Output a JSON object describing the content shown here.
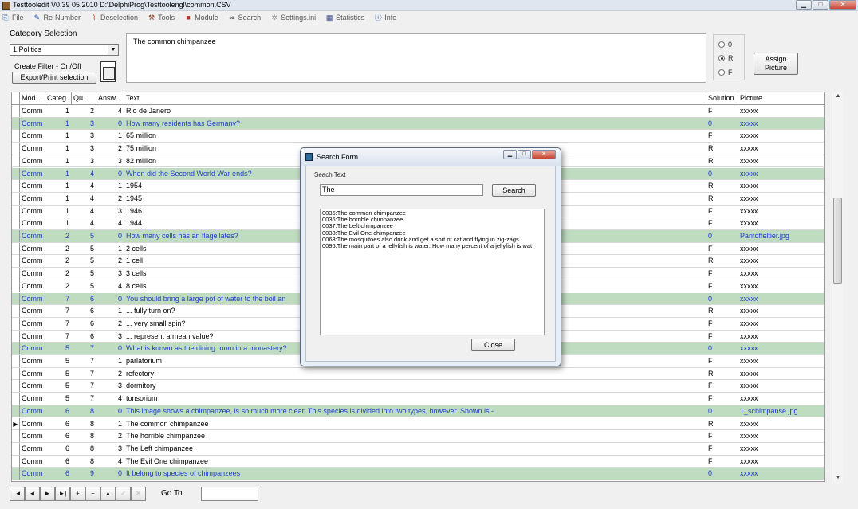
{
  "window": {
    "title": "Testtooledit V0.39 05.2010 D:\\DelphiProg\\Testtoolengl\\common.CSV"
  },
  "menu": [
    {
      "label": "File",
      "icon": "open-icon"
    },
    {
      "label": "Re-Number",
      "icon": "pen-icon"
    },
    {
      "label": "Deselection",
      "icon": "broom-icon"
    },
    {
      "label": "Tools",
      "icon": "tools-icon"
    },
    {
      "label": "Module",
      "icon": "module-icon"
    },
    {
      "label": "Search",
      "icon": "binoculars-icon"
    },
    {
      "label": "Settings.ini",
      "icon": "settings-icon"
    },
    {
      "label": "Statistics",
      "icon": "statistics-icon"
    },
    {
      "label": "Info",
      "icon": "info-icon"
    }
  ],
  "category": {
    "label": "Category Selection",
    "selected": "1.Politics"
  },
  "filter": {
    "create_label": "Create Filter - On/Off",
    "export_label": "Export/Print selection"
  },
  "memo": {
    "text": "The common chimpanzee"
  },
  "radios": [
    {
      "label": "0",
      "checked": false
    },
    {
      "label": "R",
      "checked": true
    },
    {
      "label": "F",
      "checked": false
    }
  ],
  "assign_picture": {
    "label_line1": "Assign",
    "label_line2": "Picture"
  },
  "grid": {
    "headers": [
      "Mod...",
      "Categ...",
      "Qu...",
      "Answ...",
      "Text",
      "Solution",
      "Picture"
    ],
    "rows": [
      {
        "mod": "Comm",
        "cat": "1",
        "qu": "2",
        "ans": "4",
        "text": "Rio de Janero",
        "sol": "F",
        "pic": "xxxxx",
        "q": false
      },
      {
        "mod": "Comm",
        "cat": "1",
        "qu": "3",
        "ans": "0",
        "text": "How many residents has Germany?",
        "sol": "0",
        "pic": "xxxxx",
        "q": true
      },
      {
        "mod": "Comm",
        "cat": "1",
        "qu": "3",
        "ans": "1",
        "text": "65 million",
        "sol": "F",
        "pic": "xxxxx",
        "q": false
      },
      {
        "mod": "Comm",
        "cat": "1",
        "qu": "3",
        "ans": "2",
        "text": "75 million",
        "sol": "R",
        "pic": "xxxxx",
        "q": false
      },
      {
        "mod": "Comm",
        "cat": "1",
        "qu": "3",
        "ans": "3",
        "text": "82 million",
        "sol": "R",
        "pic": "xxxxx",
        "q": false
      },
      {
        "mod": "Comm",
        "cat": "1",
        "qu": "4",
        "ans": "0",
        "text": "When did the Second World War ends?",
        "sol": "0",
        "pic": "xxxxx",
        "q": true
      },
      {
        "mod": "Comm",
        "cat": "1",
        "qu": "4",
        "ans": "1",
        "text": "1954",
        "sol": "R",
        "pic": "xxxxx",
        "q": false
      },
      {
        "mod": "Comm",
        "cat": "1",
        "qu": "4",
        "ans": "2",
        "text": "1945",
        "sol": "R",
        "pic": "xxxxx",
        "q": false
      },
      {
        "mod": "Comm",
        "cat": "1",
        "qu": "4",
        "ans": "3",
        "text": "1946",
        "sol": "F",
        "pic": "xxxxx",
        "q": false
      },
      {
        "mod": "Comm",
        "cat": "1",
        "qu": "4",
        "ans": "4",
        "text": "1944",
        "sol": "F",
        "pic": "xxxxx",
        "q": false
      },
      {
        "mod": "Comm",
        "cat": "2",
        "qu": "5",
        "ans": "0",
        "text": "How many cells has an flagellates?",
        "sol": "0",
        "pic": "Pantoffeltier.jpg",
        "q": true
      },
      {
        "mod": "Comm",
        "cat": "2",
        "qu": "5",
        "ans": "1",
        "text": "2 cells",
        "sol": "F",
        "pic": "xxxxx",
        "q": false
      },
      {
        "mod": "Comm",
        "cat": "2",
        "qu": "5",
        "ans": "2",
        "text": "1 cell",
        "sol": "R",
        "pic": "xxxxx",
        "q": false
      },
      {
        "mod": "Comm",
        "cat": "2",
        "qu": "5",
        "ans": "3",
        "text": "3 cells",
        "sol": "F",
        "pic": "xxxxx",
        "q": false
      },
      {
        "mod": "Comm",
        "cat": "2",
        "qu": "5",
        "ans": "4",
        "text": "8 cells",
        "sol": "F",
        "pic": "xxxxx",
        "q": false
      },
      {
        "mod": "Comm",
        "cat": "7",
        "qu": "6",
        "ans": "0",
        "text": "You should bring a large pot of water to the boil an",
        "sol": "0",
        "pic": "xxxxx",
        "q": true
      },
      {
        "mod": "Comm",
        "cat": "7",
        "qu": "6",
        "ans": "1",
        "text": "... fully turn on?",
        "sol": "R",
        "pic": "xxxxx",
        "q": false
      },
      {
        "mod": "Comm",
        "cat": "7",
        "qu": "6",
        "ans": "2",
        "text": "... very small spin?",
        "sol": "F",
        "pic": "xxxxx",
        "q": false
      },
      {
        "mod": "Comm",
        "cat": "7",
        "qu": "6",
        "ans": "3",
        "text": "... represent a mean value?",
        "sol": "F",
        "pic": "xxxxx",
        "q": false
      },
      {
        "mod": "Comm",
        "cat": "5",
        "qu": "7",
        "ans": "0",
        "text": "What is known as the dining room in a monastery?",
        "sol": "0",
        "pic": "xxxxx",
        "q": true
      },
      {
        "mod": "Comm",
        "cat": "5",
        "qu": "7",
        "ans": "1",
        "text": "parlatorium",
        "sol": "F",
        "pic": "xxxxx",
        "q": false
      },
      {
        "mod": "Comm",
        "cat": "5",
        "qu": "7",
        "ans": "2",
        "text": "refectory",
        "sol": "R",
        "pic": "xxxxx",
        "q": false
      },
      {
        "mod": "Comm",
        "cat": "5",
        "qu": "7",
        "ans": "3",
        "text": "dormitory",
        "sol": "F",
        "pic": "xxxxx",
        "q": false
      },
      {
        "mod": "Comm",
        "cat": "5",
        "qu": "7",
        "ans": "4",
        "text": "tonsorium",
        "sol": "F",
        "pic": "xxxxx",
        "q": false
      },
      {
        "mod": "Comm",
        "cat": "6",
        "qu": "8",
        "ans": "0",
        "text": "This image shows a chimpanzee, is so much more clear. This species is divided into two types, however. Shown is -",
        "sol": "0",
        "pic": "1_schimpanse.jpg",
        "q": true
      },
      {
        "mod": "Comm",
        "cat": "6",
        "qu": "8",
        "ans": "1",
        "text": "The common chimpanzee",
        "sol": "R",
        "pic": "xxxxx",
        "q": false,
        "current": true
      },
      {
        "mod": "Comm",
        "cat": "6",
        "qu": "8",
        "ans": "2",
        "text": "The horrible chimpanzee",
        "sol": "F",
        "pic": "xxxxx",
        "q": false
      },
      {
        "mod": "Comm",
        "cat": "6",
        "qu": "8",
        "ans": "3",
        "text": "The Left chimpanzee",
        "sol": "F",
        "pic": "xxxxx",
        "q": false
      },
      {
        "mod": "Comm",
        "cat": "6",
        "qu": "8",
        "ans": "4",
        "text": "The Evil One chimpanzee",
        "sol": "F",
        "pic": "xxxxx",
        "q": false
      },
      {
        "mod": "Comm",
        "cat": "6",
        "qu": "9",
        "ans": "0",
        "text": "It belong to species of chimpanzees",
        "sol": "0",
        "pic": "xxxxx",
        "q": true
      }
    ]
  },
  "navigator": {
    "buttons": [
      {
        "name": "first-record-button",
        "glyph": "|◄",
        "enabled": true
      },
      {
        "name": "prior-record-button",
        "glyph": "◄",
        "enabled": true
      },
      {
        "name": "next-record-button",
        "glyph": "►",
        "enabled": true
      },
      {
        "name": "last-record-button",
        "glyph": "►|",
        "enabled": true
      },
      {
        "name": "insert-record-button",
        "glyph": "+",
        "enabled": true
      },
      {
        "name": "delete-record-button",
        "glyph": "−",
        "enabled": true
      },
      {
        "name": "edit-record-button",
        "glyph": "▲",
        "enabled": true
      },
      {
        "name": "post-record-button",
        "glyph": "✓",
        "enabled": false
      },
      {
        "name": "cancel-record-button",
        "glyph": "✕",
        "enabled": false
      }
    ],
    "goto_label": "Go To",
    "goto_value": ""
  },
  "search_form": {
    "title": "Search Form",
    "label": "Seach Text",
    "input_value": "The",
    "search_button": "Search",
    "close_button": "Close",
    "results": [
      "0035:The common chimpanzee",
      "0036:The horrible chimpanzee",
      "0037:The Left chimpanzee",
      "0038:The Evil One chimpanzee",
      "0068:The mosquitoes also drink and get a sort of cat and flying in zig-zags",
      "0096:The main part of a jellyfish is water. How many percent of a jellyfish is wat"
    ]
  }
}
